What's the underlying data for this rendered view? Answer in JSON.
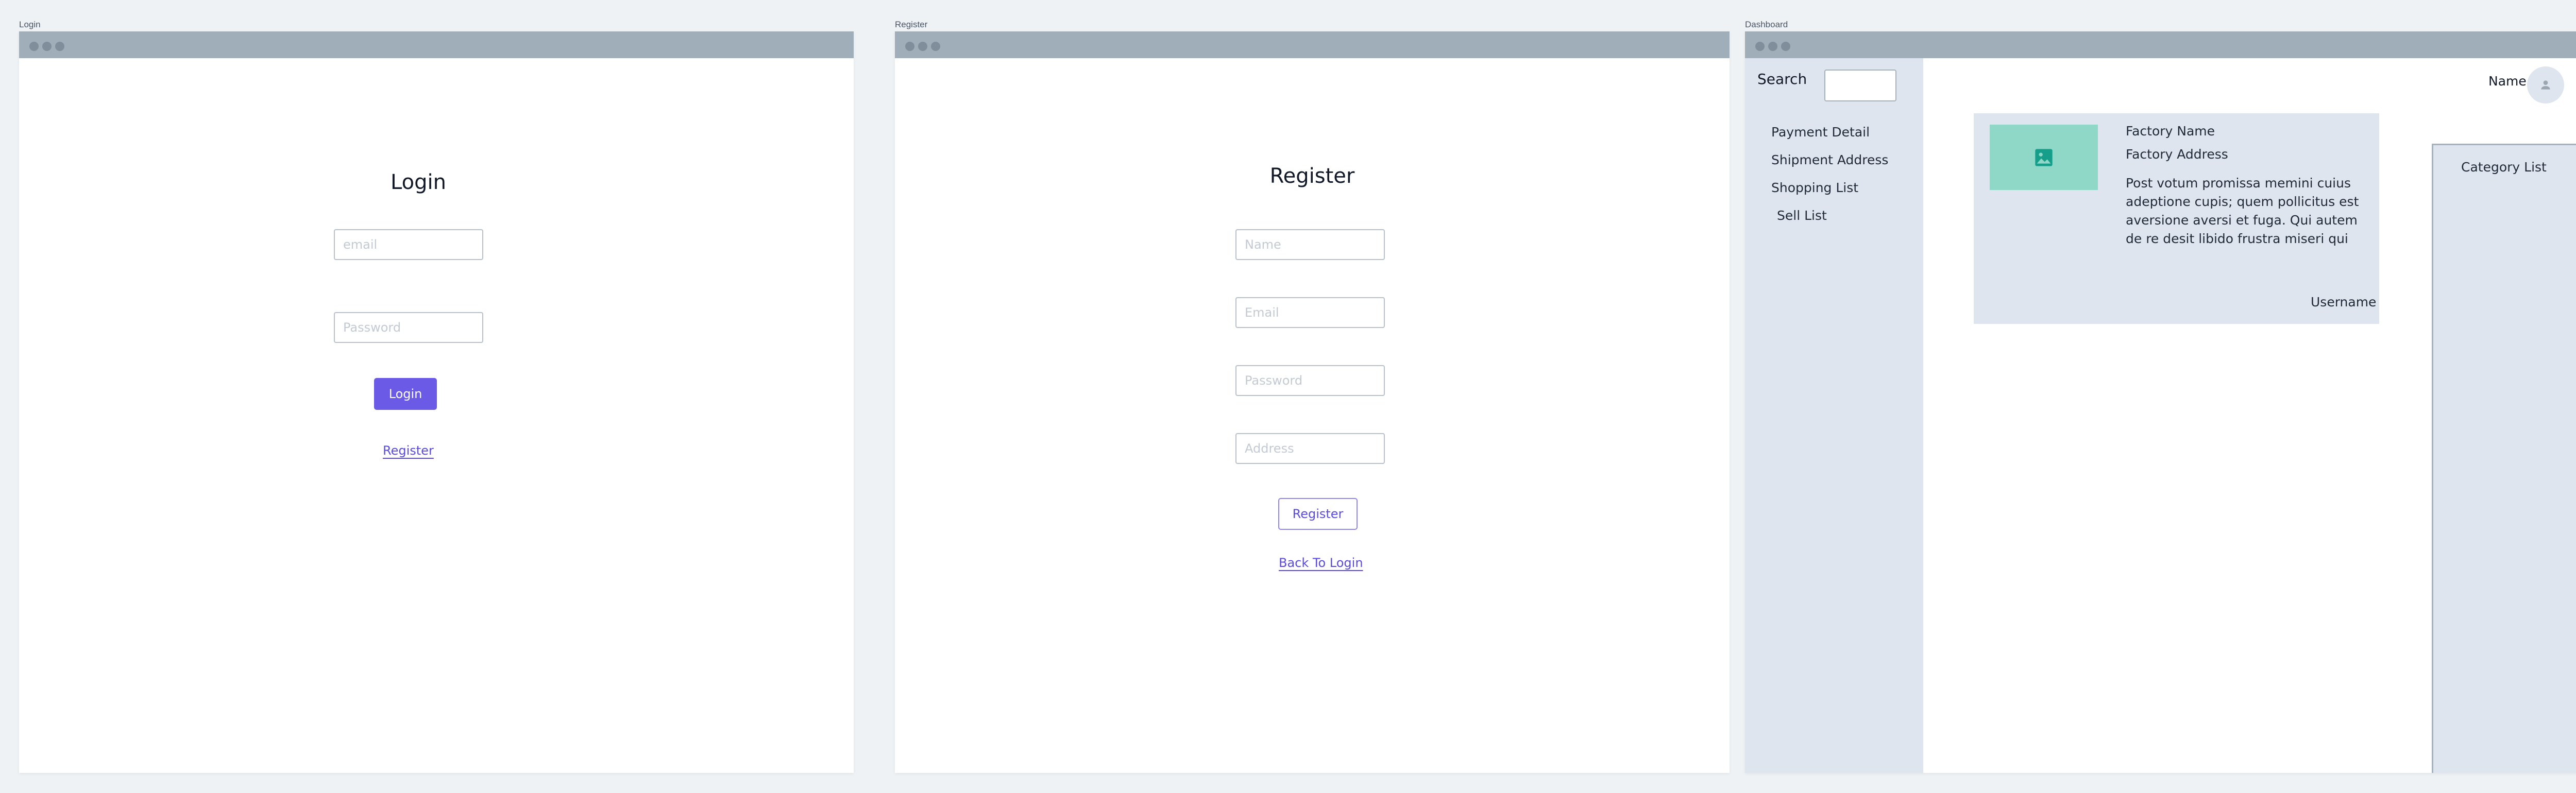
{
  "frames": {
    "login_label": "Login",
    "register_label": "Register",
    "dashboard_label": "Dashboard"
  },
  "login": {
    "title": "Login",
    "email_placeholder": "email",
    "password_placeholder": "Password",
    "submit_label": "Login",
    "register_link": "Register"
  },
  "register": {
    "title": "Register",
    "name_placeholder": "Name",
    "email_placeholder": "Email",
    "password_placeholder": "Password",
    "address_placeholder": "Address",
    "submit_label": "Register",
    "back_link": "Back To Login"
  },
  "dashboard": {
    "search_label": "Search",
    "sidebar": {
      "items": [
        {
          "label": "Payment Detail"
        },
        {
          "label": "Shipment Address"
        },
        {
          "label": "Shopping List"
        },
        {
          "label": "Sell List"
        }
      ]
    },
    "header": {
      "user_name": "Name"
    },
    "card": {
      "factory_name": "Factory Name",
      "factory_address": "Factory Address",
      "description": "Post votum promissa memini cuius adeptione cupis; quem pollicitus est aversione aversi et fuga. Qui autem de re desit libido frustra miseri qui",
      "username": "Username"
    },
    "category_list_title": "Category List"
  },
  "icons": {
    "image": "image-icon",
    "avatar": "user-icon"
  },
  "colors": {
    "primary": "#6a5ae6",
    "titlebar": "#a0aeba",
    "panel": "#dee5ee",
    "image_placeholder": "#8fd8c8",
    "image_icon": "#159e8a"
  }
}
